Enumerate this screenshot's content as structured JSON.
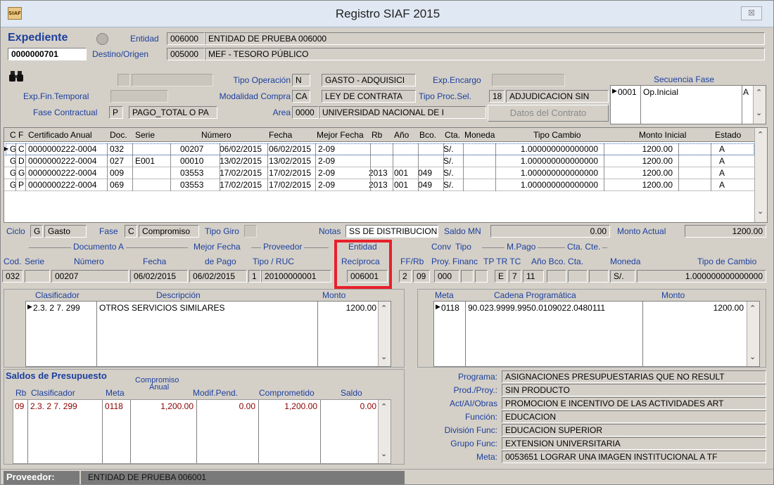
{
  "window": {
    "title": "Registro SIAF 2015",
    "app_icon": "SIAF",
    "close": "☒"
  },
  "expediente": {
    "label": "Expediente",
    "number": "0000000701",
    "entidad_label": "Entidad",
    "entidad_code": "006000",
    "entidad_name": "ENTIDAD DE PRUEBA 006000",
    "destino_label": "Destino/Origen",
    "destino_code": "005000",
    "destino_name": "MEF - TESORO PÚBLICO"
  },
  "op": {
    "tipo_operacion_label": "Tipo Operación",
    "tipo_operacion_code": "N",
    "tipo_operacion_value": "GASTO - ADQUISICI",
    "exp_encargo_label": "Exp.Encargo",
    "exp_fin_label": "Exp.Fin.Temporal",
    "modalidad_label": "Modalidad Compra",
    "modalidad_code": "CA",
    "modalidad_value": "LEY DE CONTRATA",
    "tipo_proc_label": "Tipo Proc.Sel.",
    "tipo_proc_code": "18",
    "tipo_proc_value": "ADJUDICACION SIN",
    "fase_label": "Fase Contractual",
    "fase_code": "P",
    "fase_value": "PAGO_TOTAL O PA",
    "area_label": "Area",
    "area_code": "0000",
    "area_value": "UNIVERSIDAD NACIONAL DE I",
    "datos_contrato": "Datos del Contrato"
  },
  "secuencia": {
    "header": "Secuencia Fase",
    "code": "0001",
    "name": "Op.Inicial",
    "flag": "A"
  },
  "cert_table": {
    "headers": [
      "C",
      "F",
      "Certificado Anual",
      "Doc.",
      "Serie",
      "Número",
      "Fecha",
      "Mejor Fecha",
      "Rb",
      "Año",
      "Bco.",
      "Cta.",
      "Moneda",
      "Tipo Cambio",
      "Monto Inicial",
      "Estado"
    ],
    "rows": [
      [
        "G",
        "C",
        "0000000222-0004",
        "032",
        "",
        "00207",
        "06/02/2015",
        "06/02/2015",
        "2-09",
        "",
        "",
        "",
        "S/.",
        "1.000000000000000",
        "1200.00",
        "A"
      ],
      [
        "G",
        "D",
        "0000000222-0004",
        "027",
        "E001",
        "00010",
        "13/02/2015",
        "13/02/2015",
        "2-09",
        "",
        "",
        "",
        "S/.",
        "1.000000000000000",
        "1200.00",
        "A"
      ],
      [
        "G",
        "G",
        "0000000222-0004",
        "009",
        "",
        "03553",
        "17/02/2015",
        "17/02/2015",
        "2-09",
        "2013",
        "001",
        "049",
        "S/.",
        "1.000000000000000",
        "1200.00",
        "A"
      ],
      [
        "G",
        "P",
        "0000000222-0004",
        "069",
        "",
        "03553",
        "17/02/2015",
        "17/02/2015",
        "2-09",
        "2013",
        "001",
        "049",
        "S/.",
        "1.000000000000000",
        "1200.00",
        "A"
      ]
    ]
  },
  "ciclo": {
    "ciclo_label": "Ciclo",
    "ciclo_code": "G",
    "ciclo_value": "Gasto",
    "fase_label": "Fase",
    "fase_code": "C",
    "fase_value": "Compromiso",
    "tipo_giro_label": "Tipo Giro",
    "notas_label": "Notas",
    "notas_value": "SS DE DISTRIBUCION D",
    "saldo_label": "Saldo MN",
    "saldo_value": "0.00",
    "monto_actual_label": "Monto Actual",
    "monto_actual_value": "1200.00"
  },
  "doc": {
    "documento_a": "Documento A",
    "cod_label": "Cod.",
    "serie_label": "Serie",
    "numero_label": "Número",
    "fecha_label": "Fecha",
    "mejor_fecha_label1": "Mejor Fecha",
    "mejor_fecha_label2": "de Pago",
    "proveedor_label": "Proveedor",
    "tipo_ruc_label": "Tipo / RUC",
    "entidad_label": "Entidad",
    "reciproca_label": "Recíproca",
    "ffrb_label": "FF/Rb",
    "conv_label": "Conv",
    "proy_label": "Proy.",
    "tipo_label": "Tipo",
    "financ_label": "Financ",
    "mpago_label": "M.Pago",
    "tptrtc_label": "TP TR TC",
    "ctacte_label": "Cta. Cte.",
    "anio_bco_cta_label": "Año  Bco.  Cta.",
    "moneda_label": "Moneda",
    "tipo_cambio_label": "Tipo de Cambio",
    "cod": "032",
    "numero": "00207",
    "fecha": "06/02/2015",
    "mejor_fecha": "06/02/2015",
    "tipo": "1",
    "ruc": "20100000001",
    "entidad_reciproca": "006001",
    "ff": "2",
    "rb": "09",
    "conv": "000",
    "tp": "E",
    "tr": "7",
    "tc": "11",
    "moneda": "S/.",
    "tipo_cambio": "1.000000000000000"
  },
  "clasificador": {
    "h_clasificador": "Clasificador",
    "h_descripcion": "Descripción",
    "h_monto": "Monto",
    "code": "2.3. 2 7. 299",
    "desc": "OTROS SERVICIOS SIMILARES",
    "monto": "1200.00"
  },
  "meta": {
    "h_meta": "Meta",
    "h_cadena": "Cadena Programática",
    "h_monto": "Monto",
    "meta": "0118",
    "cadena": "90.023.9999.9950.0109022.0480111",
    "monto": "1200.00"
  },
  "saldos": {
    "title": "Saldos de Presupuesto",
    "h_rb": "Rb",
    "h_clasificador": "Clasificador",
    "h_meta": "Meta",
    "h_comp1": "Compromiso",
    "h_comp2": "Anual",
    "h_modif": "Modif.Pend.",
    "h_comprometido": "Comprometido",
    "h_saldo": "Saldo",
    "rb": "09",
    "clasificador": "2.3. 2 7. 299",
    "meta": "0118",
    "compromiso": "1,200.00",
    "modif": "0.00",
    "comprometido": "1,200.00",
    "saldo": "0.00"
  },
  "programa": [
    {
      "label": "Programa:",
      "value": "ASIGNACIONES PRESUPUESTARIAS QUE NO RESULT"
    },
    {
      "label": "Prod./Proy.:",
      "value": "SIN PRODUCTO"
    },
    {
      "label": "Act/AI/Obras",
      "value": "PROMOCION E INCENTIVO DE LAS ACTIVIDADES ART"
    },
    {
      "label": "Función:",
      "value": "EDUCACION"
    },
    {
      "label": "División Func:",
      "value": "EDUCACION SUPERIOR"
    },
    {
      "label": "Grupo Func:",
      "value": "EXTENSION UNIVERSITARIA"
    },
    {
      "label": "Meta:",
      "value": "0053651  LOGRAR UNA IMAGEN INSTITUCIONAL A TF"
    }
  ],
  "status": {
    "label": "Proveedor:",
    "value": "ENTIDAD DE PRUEBA 006001"
  },
  "icons": {
    "binoculars": "binoculars-icon",
    "row_pointer": "▶",
    "up": "▲",
    "down": "▼"
  },
  "colors": {
    "label_blue": "#1c3f9e",
    "highlight_red": "#e8202a",
    "saldos_red": "#8b0000"
  }
}
